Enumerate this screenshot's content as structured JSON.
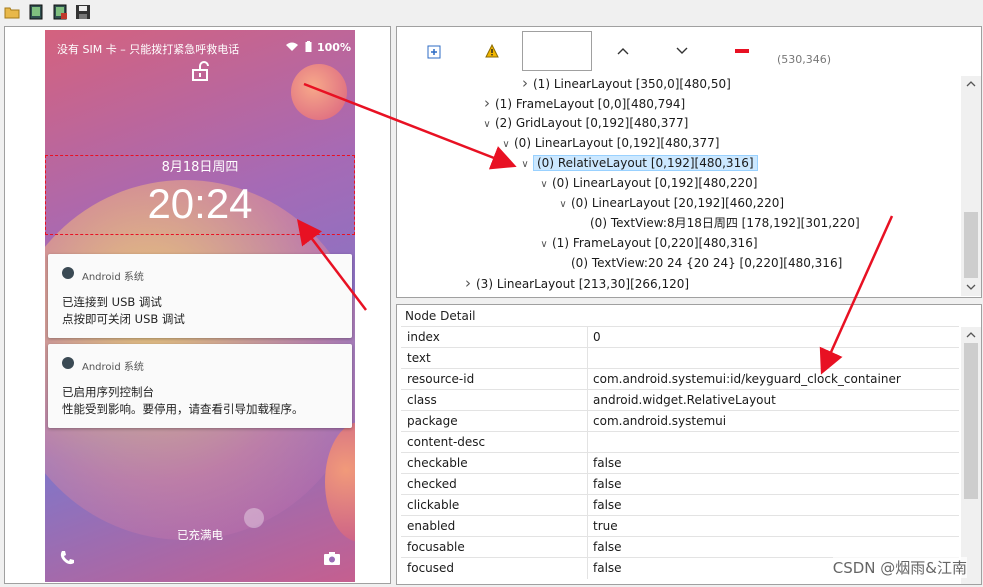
{
  "toolbar": {
    "icons": [
      "open-folder-icon",
      "screenshot-icon",
      "screenshot-compressed-icon",
      "save-icon"
    ]
  },
  "phone": {
    "status_left": "没有 SIM 卡 – 只能拨打紧急呼救电话",
    "status_right": "100%",
    "date": "8月18日周四",
    "time": "20:24",
    "charging": "已充满电",
    "notifications": [
      {
        "app": "Android 系统",
        "line1": "已连接到 USB 调试",
        "line2": "点按即可关闭 USB 调试"
      },
      {
        "app": "Android 系统",
        "line1": "已启用序列控制台",
        "line2": "性能受到影响。要停用，请查看引导加载程序。"
      }
    ]
  },
  "tree_toolbar": {
    "coords": "(530,346)"
  },
  "tree": [
    {
      "depth": 5,
      "chev": "right",
      "text": "(1) LinearLayout [350,0][480,50]"
    },
    {
      "depth": 3,
      "chev": "right",
      "text": "(1) FrameLayout [0,0][480,794]"
    },
    {
      "depth": 3,
      "chev": "down",
      "text": "(2) GridLayout [0,192][480,377]"
    },
    {
      "depth": 4,
      "chev": "down",
      "text": "(0) LinearLayout [0,192][480,377]"
    },
    {
      "depth": 5,
      "chev": "down",
      "text": "(0) RelativeLayout [0,192][480,316]",
      "selected": true
    },
    {
      "depth": 6,
      "chev": "down",
      "text": "(0) LinearLayout [0,192][480,220]"
    },
    {
      "depth": 7,
      "chev": "down",
      "text": "(0) LinearLayout [20,192][460,220]"
    },
    {
      "depth": 8,
      "chev": "none",
      "text": "(0) TextView:8月18日周四 [178,192][301,220]"
    },
    {
      "depth": 6,
      "chev": "down",
      "text": "(1) FrameLayout [0,220][480,316]"
    },
    {
      "depth": 7,
      "chev": "none",
      "text": "(0) TextView:20   24 {20   24} [0,220][480,316]"
    },
    {
      "depth": 2,
      "chev": "right",
      "text": "(3) LinearLayout [213,30][266,120]"
    }
  ],
  "detail": {
    "title": "Node Detail",
    "rows": [
      {
        "k": "index",
        "v": "0"
      },
      {
        "k": "text",
        "v": ""
      },
      {
        "k": "resource-id",
        "v": "com.android.systemui:id/keyguard_clock_container"
      },
      {
        "k": "class",
        "v": "android.widget.RelativeLayout"
      },
      {
        "k": "package",
        "v": "com.android.systemui"
      },
      {
        "k": "content-desc",
        "v": ""
      },
      {
        "k": "checkable",
        "v": "false"
      },
      {
        "k": "checked",
        "v": "false"
      },
      {
        "k": "clickable",
        "v": "false"
      },
      {
        "k": "enabled",
        "v": "true"
      },
      {
        "k": "focusable",
        "v": "false"
      },
      {
        "k": "focused",
        "v": "false"
      }
    ]
  },
  "watermark": "CSDN @烟雨&江南",
  "colors": {
    "accent": "#e81123",
    "selection": "#cce8ff"
  }
}
